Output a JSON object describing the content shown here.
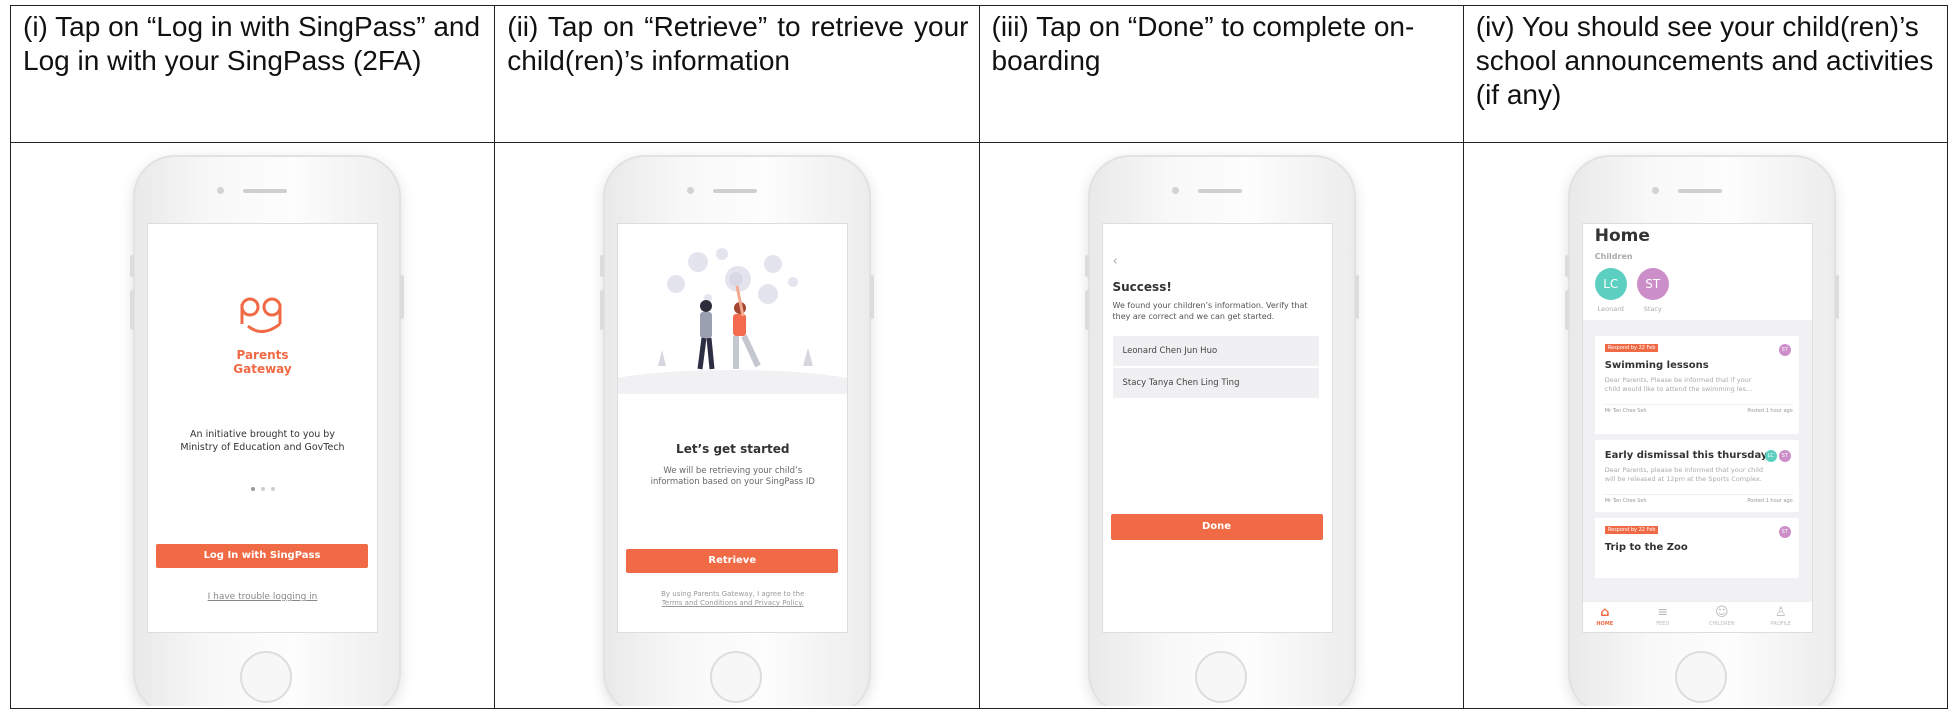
{
  "steps": [
    {
      "caption": "(i) Tap on “Log in with SingPass” and Log in with your SingPass (2FA)"
    },
    {
      "caption": "(ii) Tap on “Retrieve” to retrieve your child(ren)’s information"
    },
    {
      "caption": "(iii) Tap on “Done” to complete on-boarding"
    },
    {
      "caption": "(iv) You should see your child(ren)’s school announcements and activities (if any)"
    }
  ],
  "screen1": {
    "logo_text": "pg",
    "brand_line1": "Parents",
    "brand_line2": "Gateway",
    "initiative_line1": "An initiative brought to you by",
    "initiative_line2": "Ministry of Education and GovTech",
    "login_button": "Log In with SingPass",
    "trouble_link": "I have trouble logging in"
  },
  "screen2": {
    "title": "Let’s get started",
    "desc_line1": "We will be retrieving your child’s",
    "desc_line2": "information based on your SingPass ID",
    "retrieve_button": "Retrieve",
    "terms_line1": "By using Parents Gateway, I agree to the",
    "terms_line2": "Terms and Conditions and Privacy Policy."
  },
  "screen3": {
    "back_glyph": "‹",
    "title": "Success!",
    "desc": "We found your children’s information. Verify that they are correct and we can get started.",
    "children": [
      "Leonard Chen Jun Huo",
      "Stacy Tanya Chen Ling Ting"
    ],
    "done_button": "Done"
  },
  "screen4": {
    "title": "Home",
    "children_label": "Children",
    "avatars": [
      {
        "initials": "LC",
        "name": "Leonard",
        "color": "#5ccfc0"
      },
      {
        "initials": "ST",
        "name": "Stacy",
        "color": "#cc8ec9"
      }
    ],
    "cards": [
      {
        "tag": "Respond by 22 Feb",
        "title": "Swimming lessons",
        "body_line1": "Dear Parents, Please be informed that if your",
        "body_line2": "child would like to attend the swimming les...",
        "footer_left": "Mr Tan Chee Seh",
        "footer_right": "Posted 1 hour ago"
      },
      {
        "title": "Early dismissal this thursday",
        "body_line1": "Dear Parents, please be informed that your child",
        "body_line2": "will be released at 12pm at the Sports Complex.",
        "footer_left": "Mr Tan Chee Seh",
        "footer_right": "Posted 1 hour ago"
      },
      {
        "tag": "Respond by 22 Feb",
        "title": "Trip to the Zoo"
      }
    ],
    "tabs": [
      "HOME",
      "FEED",
      "CHILDREN",
      "PROFILE"
    ],
    "colors": {
      "accent": "#f06a45"
    }
  }
}
